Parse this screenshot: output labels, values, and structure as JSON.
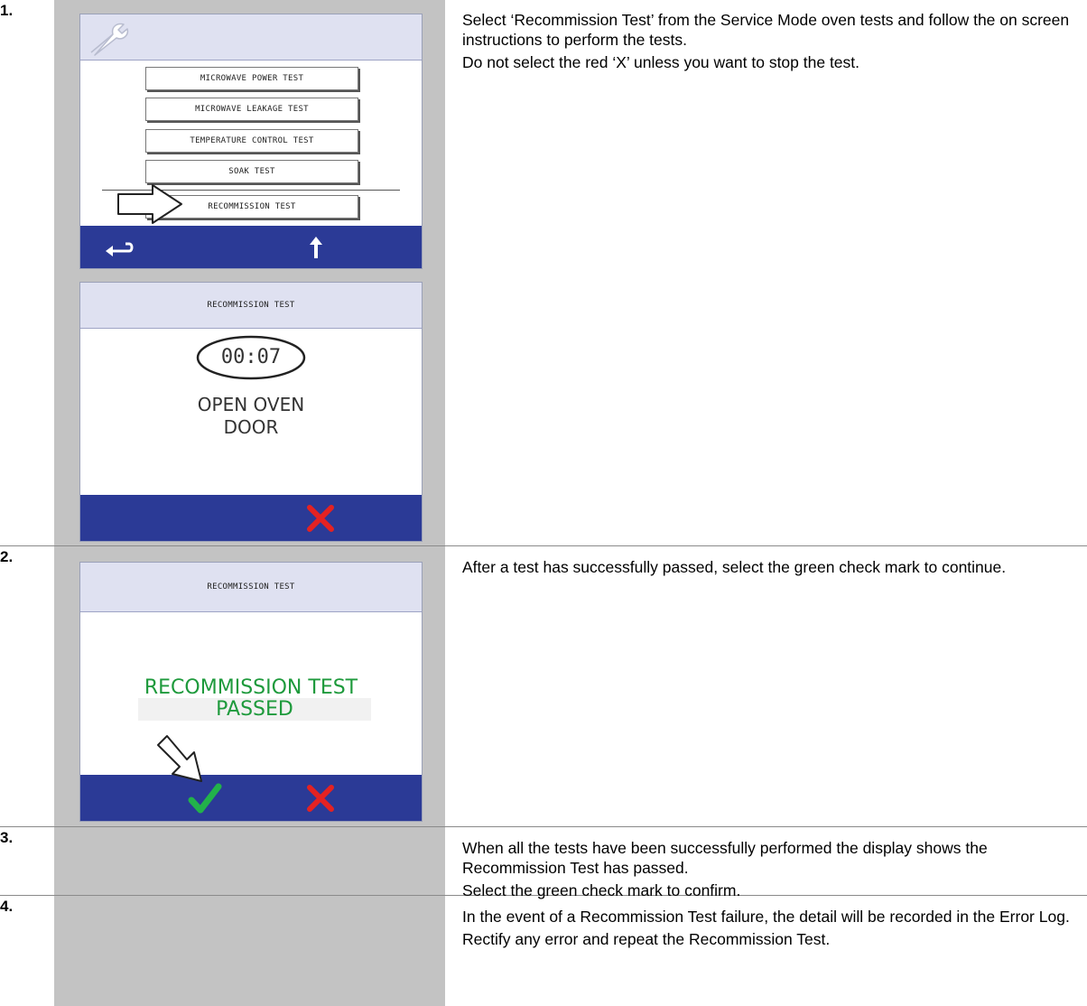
{
  "steps": [
    {
      "number": "1.",
      "paragraphs": [
        "Select ‘Recommission Test’ from the Service Mode oven tests and follow the on screen instructions to perform the tests.",
        "Do not select the red ‘X’ unless you want to stop the test."
      ]
    },
    {
      "number": "2.",
      "paragraphs": [
        "After a test has successfully passed, select the green check mark to continue."
      ]
    },
    {
      "number": "3.",
      "paragraphs": [
        "When all the tests have been successfully performed the display shows the Recommission Test has passed.",
        "Select the green check mark to confirm."
      ]
    },
    {
      "number": "4.",
      "paragraphs": [
        "In the event of a Recommission Test failure, the detail will be recorded in the Error Log.",
        "Rectify any error and repeat the Recommission Test."
      ]
    }
  ],
  "screen_menu": {
    "header_icon": "wrench-icon",
    "buttons": [
      "MICROWAVE POWER TEST",
      "MICROWAVE LEAKAGE TEST",
      "TEMPERATURE CONTROL TEST",
      "SOAK TEST",
      "RECOMMISSION TEST"
    ],
    "footer_icons": [
      "back-arrow-icon",
      "up-arrow-icon"
    ]
  },
  "screen_running": {
    "title": "RECOMMISSION TEST",
    "timer": "00:07",
    "message_line1": "OPEN OVEN",
    "message_line2": "DOOR",
    "footer_icons": [
      "red-x-icon"
    ]
  },
  "screen_passed": {
    "title": "RECOMMISSION TEST",
    "message_line1": "RECOMMISSION TEST",
    "message_line2": "PASSED",
    "footer_icons": [
      "green-check-icon",
      "red-x-icon"
    ]
  },
  "colors": {
    "footer_blue": "#2b3a96",
    "header_lavender": "#dfe1f1",
    "passed_green": "#1e9a3c",
    "cancel_red": "#e42222",
    "panel_gray": "#c3c3c3"
  }
}
